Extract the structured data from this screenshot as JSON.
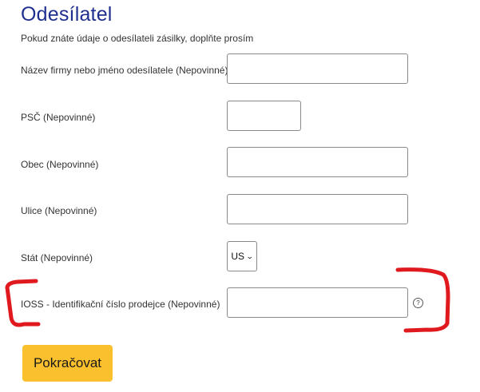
{
  "section": {
    "title": "Odesílatel",
    "intro": "Pokud znáte údaje o odesílateli zásilky, doplňte prosím"
  },
  "fields": {
    "company": {
      "label": "Název firmy nebo jméno odesílatele  (Nepovinné)",
      "value": ""
    },
    "zip": {
      "label": "PSČ (Nepovinné)",
      "value": ""
    },
    "city": {
      "label": "Obec (Nepovinné)",
      "value": ""
    },
    "street": {
      "label": "Ulice (Nepovinné)",
      "value": ""
    },
    "country": {
      "label": "Stát (Nepovinné)",
      "selected": "US"
    },
    "ioss": {
      "label": "IOSS - Identifikační číslo prodejce (Nepovinné)",
      "value": "",
      "help_glyph": "?"
    }
  },
  "actions": {
    "continue_label": "Pokračovat"
  },
  "colors": {
    "title": "#1e2f8f",
    "button": "#fbc02d",
    "annotation": "#e0191f"
  },
  "icons": {
    "help": "question-circle-icon",
    "dropdown": "chevron-down-icon"
  }
}
